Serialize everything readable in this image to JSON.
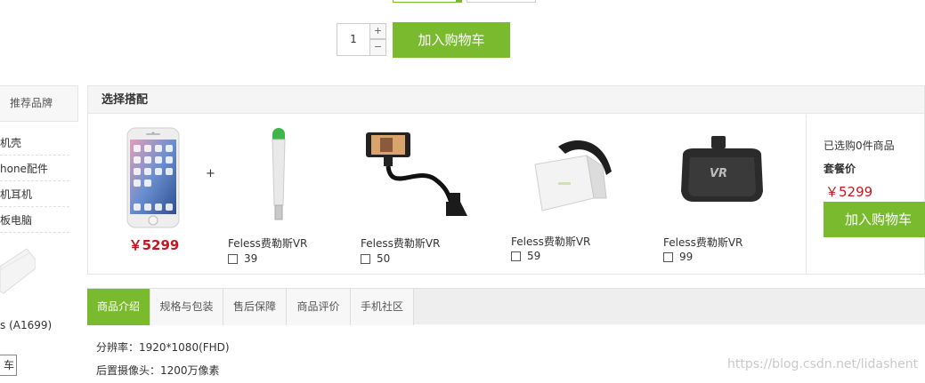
{
  "quantity": {
    "value": "1",
    "plus": "+",
    "minus": "−"
  },
  "add_to_cart_top": "加入购物车",
  "sidebar": {
    "header": "推荐品牌",
    "items": [
      "机壳",
      "hone配件",
      "机耳机",
      "板电脑"
    ],
    "product_name": "s (A1699)",
    "product_button": "车"
  },
  "combo": {
    "title": "选择搭配",
    "main_product": {
      "price": "￥5299",
      "image": "iphone-image"
    },
    "plus": "+",
    "accessories": [
      {
        "name": "Feless费勒斯VR",
        "price": "39",
        "image": "usb-lamp-image"
      },
      {
        "name": "Feless费勒斯VR",
        "price": "50",
        "image": "phone-holder-image"
      },
      {
        "name": "Feless费勒斯VR",
        "price": "59",
        "image": "vr-headset-white-image"
      },
      {
        "name": "Feless费勒斯VR",
        "price": "99",
        "image": "vr-headset-black-image"
      }
    ],
    "selected_count": "已选购0件商品",
    "combo_price_label": "套餐价",
    "combo_price": "￥5299",
    "add_to_cart": "加入购物车"
  },
  "tabs": [
    "商品介绍",
    "规格与包装",
    "售后保障",
    "商品评价",
    "手机社区"
  ],
  "specs": [
    "分辨率：1920*1080(FHD)",
    "后置摄像头：1200万像素"
  ],
  "watermark": "https://blog.csdn.net/lidashent",
  "colors": {
    "accent": "#7aba2f",
    "price": "#c7161d"
  }
}
